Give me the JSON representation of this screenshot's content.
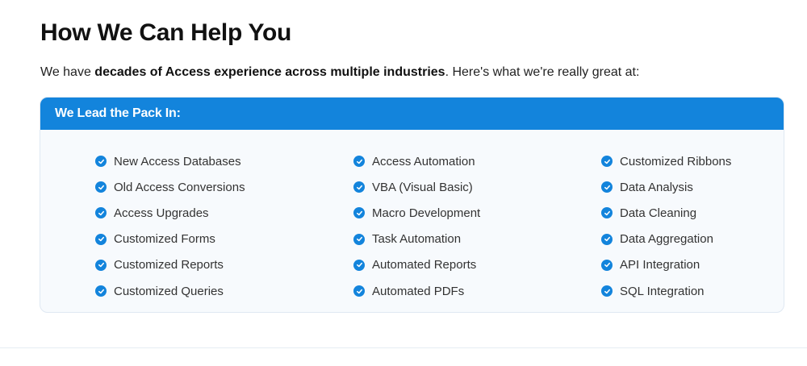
{
  "section": {
    "title": "How We Can Help You",
    "intro_prefix": "We have ",
    "intro_bold": "decades of Access experience across multiple industries",
    "intro_suffix": ". Here's what we're really great at:"
  },
  "card": {
    "header": "We Lead the Pack In:",
    "accent_color": "#1384DC",
    "columns": [
      [
        "New Access Databases",
        "Old Access Conversions",
        "Access Upgrades",
        "Customized Forms",
        "Customized Reports",
        "Customized Queries"
      ],
      [
        "Access Automation",
        "VBA (Visual Basic)",
        "Macro Development",
        "Task Automation",
        "Automated Reports",
        "Automated PDFs"
      ],
      [
        "Customized Ribbons",
        "Data Analysis",
        "Data Cleaning",
        "Data Aggregation",
        "API Integration",
        "SQL Integration"
      ]
    ],
    "item_icon": "check-circle-icon"
  }
}
